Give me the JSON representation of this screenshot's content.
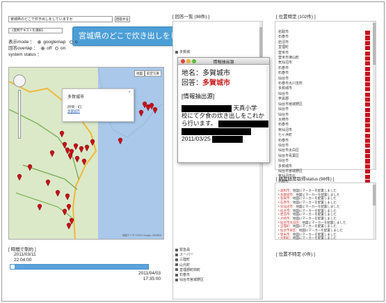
{
  "search": {
    "query": "宮城県のどこで炊き出しをしていますか",
    "send_label": "回答する",
    "select_label": "《質問テキストを選択》"
  },
  "tooltip": {
    "text": "宮城県のどこで炊き出しをしていますか"
  },
  "options": {
    "display_mode_label": "表示mode",
    "display_mode_value": "googlemap",
    "display_mode_alt": "o",
    "overlap_label": "回答overlap",
    "overlap_off": "off",
    "overlap_on": "on",
    "system_status_label": "system status"
  },
  "map": {
    "maptype_map": "地図",
    "maptype_satellite": "航空写真",
    "info_title": "多賀城市",
    "info_meta": "[時間・町]",
    "info_link": "多賀城市",
    "credit": "地図データ ©2015 Google, ZENRIN"
  },
  "timeline": {
    "header": "[ 時間で制約 ]",
    "start_date": "2011/03/11",
    "start_time": "22:04:00",
    "end_date": "2011/04/03",
    "end_time": "17:35:00",
    "position_fraction": 0.0
  },
  "answers": {
    "header": "[ 回答一覧 (98件) ]",
    "top_item": "多賀城",
    "items": [
      "緊急員",
      "スーパー",
      "三陸町",
      "山元町",
      "亘理郡町田町",
      "石巻市",
      "仙台市宮城野区"
    ]
  },
  "dialog": {
    "title": "情報抽出源",
    "place_label": "地名：",
    "place_value": "多賀城市",
    "answer_label": "回答：",
    "answer_value": "多賀城市",
    "source_header": "[情報抽出源]",
    "text1": "天真小学",
    "text2": "校にて夕食の炊き出しをこれか",
    "text3": "ら行います。",
    "date": "2011/03/25"
  },
  "locations": {
    "header": "[ 位置特定 (102件) ]",
    "items": [
      "名取市",
      "石巻市",
      "岩沼市",
      "亘理町",
      "登米市",
      "登米市津山町",
      "気仙沼市",
      "石巻市",
      "石巻市",
      "仙台市",
      "石巻市大川支所",
      "多賀城市",
      "仙台市",
      "伊具郡",
      "仙台市宮城野区",
      "仙台市",
      "仙台市",
      "大崎市",
      "石巻市",
      "気仙沼市",
      "七ヶ浜町",
      "石巻市",
      "仙台市",
      "仙台市太白区",
      "仙台市青葉区",
      "仙台市",
      "多賀城市",
      "仙台市宮城野区",
      "気仙沼市北",
      "名取市",
      "登米市"
    ],
    "bar_count": 31
  },
  "geocode": {
    "header": "[ 精度経度取得status (98件) ]",
    "items": [
      {
        "place": "美和市",
        "status": "地図にマーカーを配置しました"
      },
      {
        "place": "多賀城市",
        "status": "地図にマーカーを配置しました"
      },
      {
        "place": "名取市",
        "status": "地図にマーカーを配置しました"
      },
      {
        "place": "石巻市",
        "status": "地図にマーカーを配置しました"
      },
      {
        "place": "気仙沼市",
        "status": "地図にマーカーを配置しました"
      },
      {
        "place": "仙台市",
        "status": "地図にマーカーを配置しました"
      },
      {
        "place": "岩沼市",
        "status": "地図にマーカーを配置しました"
      },
      {
        "place": "大崎市",
        "status": "地図にマーカーを配置しました"
      },
      {
        "place": "仙台市太白区",
        "status": "地図にマーカーを配置しました"
      },
      {
        "place": "亘理町",
        "status": "地図にマーカーを配置しました"
      },
      {
        "place": "仙台市泉区",
        "status": "地図にマーカーを配置しました"
      },
      {
        "place": "登米市",
        "status": "地図にマーカーを配置しました"
      },
      {
        "place": "大和町",
        "status": "地図にマーカーを配置しました"
      }
    ]
  },
  "not_found": {
    "header": "[ 位置不特定 (0件) ]"
  },
  "colors": {
    "accent_blue": "#4c9fd6",
    "marker_red": "#c8101b",
    "answer_red": "#cc1d1d"
  }
}
